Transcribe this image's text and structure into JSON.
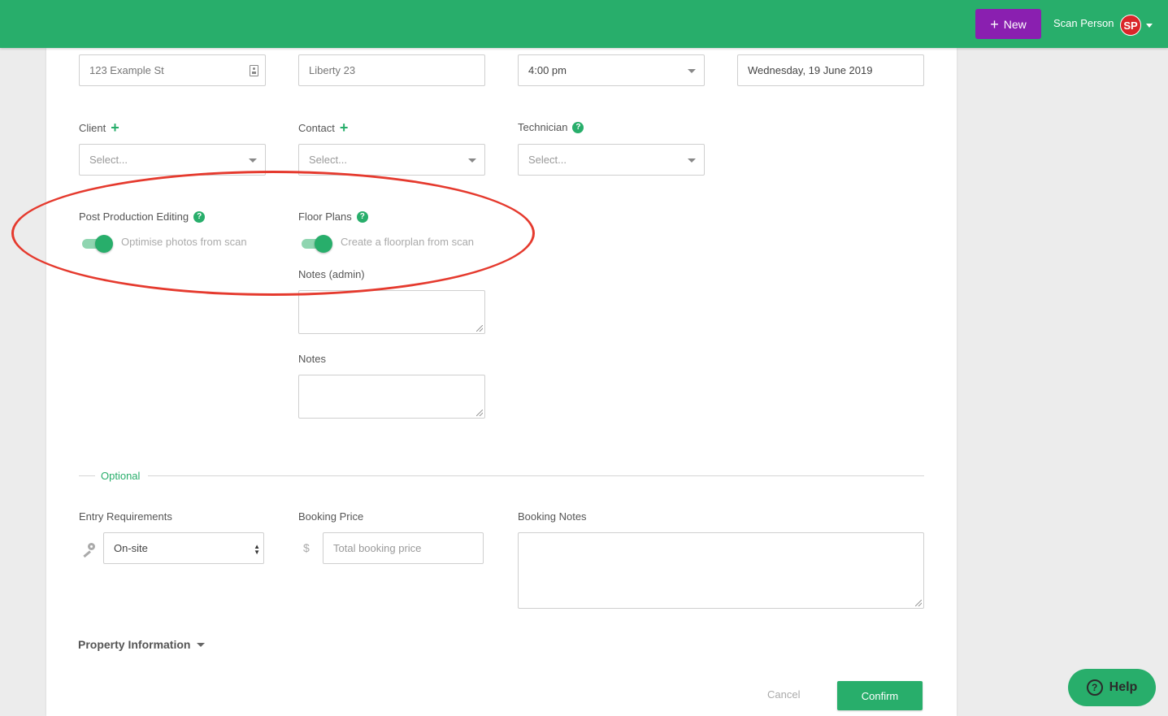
{
  "header": {
    "new_label": "New",
    "user_name": "Scan Person",
    "avatar_initials": "SP"
  },
  "top_row": {
    "address_value": "123 Example St",
    "unit_value": "Liberty 23",
    "time_value": "4:00 pm",
    "date_value": "Wednesday, 19 June 2019"
  },
  "people": {
    "client_label": "Client",
    "client_placeholder": "Select...",
    "contact_label": "Contact",
    "contact_placeholder": "Select...",
    "technician_label": "Technician",
    "technician_placeholder": "Select..."
  },
  "options": {
    "post_production_label": "Post Production Editing",
    "post_production_text": "Optimise photos from scan",
    "post_production_on": true,
    "floor_plans_label": "Floor Plans",
    "floor_plans_text": "Create a floorplan from scan",
    "floor_plans_on": true
  },
  "notes": {
    "admin_label": "Notes (admin)",
    "notes_label": "Notes"
  },
  "optional": {
    "title": "Optional",
    "entry_label": "Entry Requirements",
    "entry_value": "On-site",
    "price_label": "Booking Price",
    "price_symbol": "$",
    "price_placeholder": "Total booking price",
    "booking_notes_label": "Booking Notes"
  },
  "property_info_label": "Property Information",
  "actions": {
    "cancel_label": "Cancel",
    "confirm_label": "Confirm"
  },
  "help_label": "Help",
  "colors": {
    "brand_green": "#28ae6b",
    "new_button": "#8a1fb0",
    "annotation_red": "#e53a2e"
  }
}
